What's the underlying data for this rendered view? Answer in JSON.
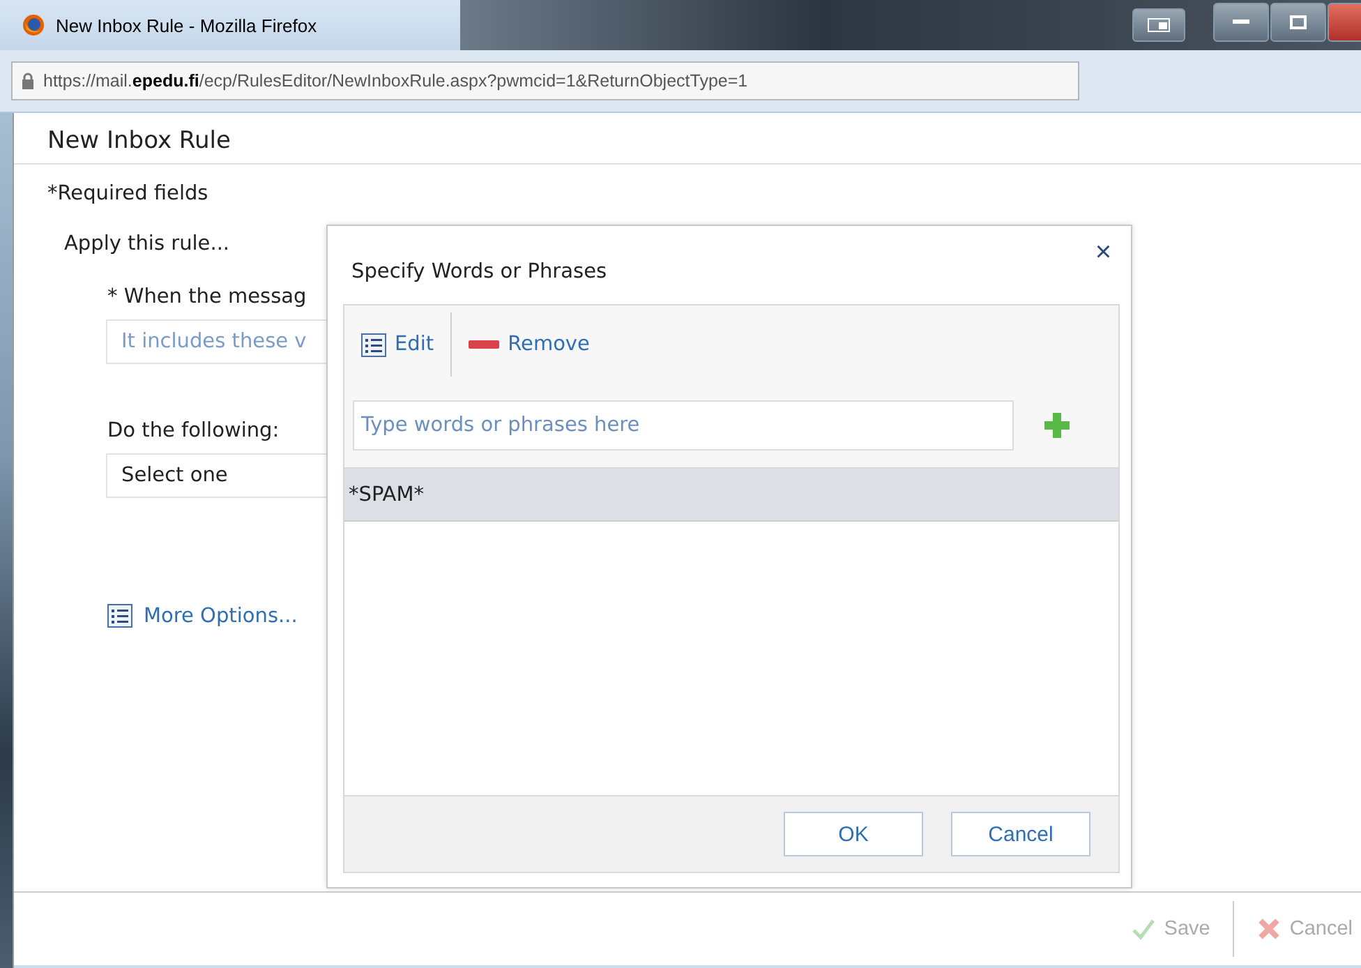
{
  "window": {
    "title": "New Inbox Rule - Mozilla Firefox"
  },
  "address_bar": {
    "url": "https://mail.**epedu.fi**/ecp/RulesEditor/NewInboxRule.aspx?pwmcid=1&ReturnObjectType=1"
  },
  "page": {
    "title": "New Inbox Rule",
    "required_note": "*Required fields",
    "apply_label": "Apply this rule...",
    "condition_label": "* When the messag",
    "condition_value": "It includes these v",
    "action_label": "Do the following:",
    "action_value": "Select one",
    "more_options": "More Options..."
  },
  "dialog": {
    "title": "Specify Words or Phrases",
    "close": "×",
    "toolbar": [
      {
        "kind": "edit",
        "label": "Edit"
      },
      {
        "kind": "remove",
        "label": "Remove"
      }
    ],
    "input": {
      "placeholder": "Type words or phrases here"
    },
    "items": [
      {
        "text": "*SPAM*",
        "selected": true
      }
    ],
    "buttons": [
      "OK",
      "Cancel"
    ]
  },
  "footer": {
    "buttons": [
      {
        "kind": "save",
        "label": "Save",
        "disabled": true
      },
      {
        "kind": "cancel",
        "label": "Cancel",
        "disabled": true
      }
    ]
  }
}
